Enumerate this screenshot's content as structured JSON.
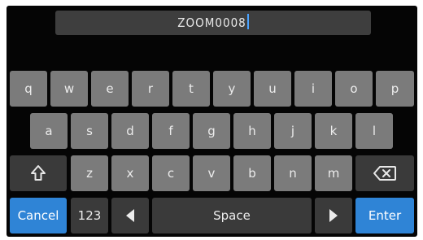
{
  "name_field": {
    "value": "ZOOM0008"
  },
  "keyboard": {
    "row1": [
      "q",
      "w",
      "e",
      "r",
      "t",
      "y",
      "u",
      "i",
      "o",
      "p"
    ],
    "row2": [
      "a",
      "s",
      "d",
      "f",
      "g",
      "h",
      "j",
      "k",
      "l"
    ],
    "row3": [
      "z",
      "x",
      "c",
      "v",
      "b",
      "n",
      "m"
    ],
    "bottom": {
      "cancel": "Cancel",
      "numbers": "123",
      "space": "Space",
      "enter": "Enter"
    },
    "icons": {
      "shift": "shift-arrow-icon",
      "backspace": "backspace-icon",
      "cursor_left": "triangle-left-icon",
      "cursor_right": "triangle-right-icon"
    },
    "colors": {
      "key": "#7b7b7b",
      "function_key": "#3a3a3a",
      "accent": "#2f84d6",
      "cursor": "#4aa3ff"
    }
  }
}
